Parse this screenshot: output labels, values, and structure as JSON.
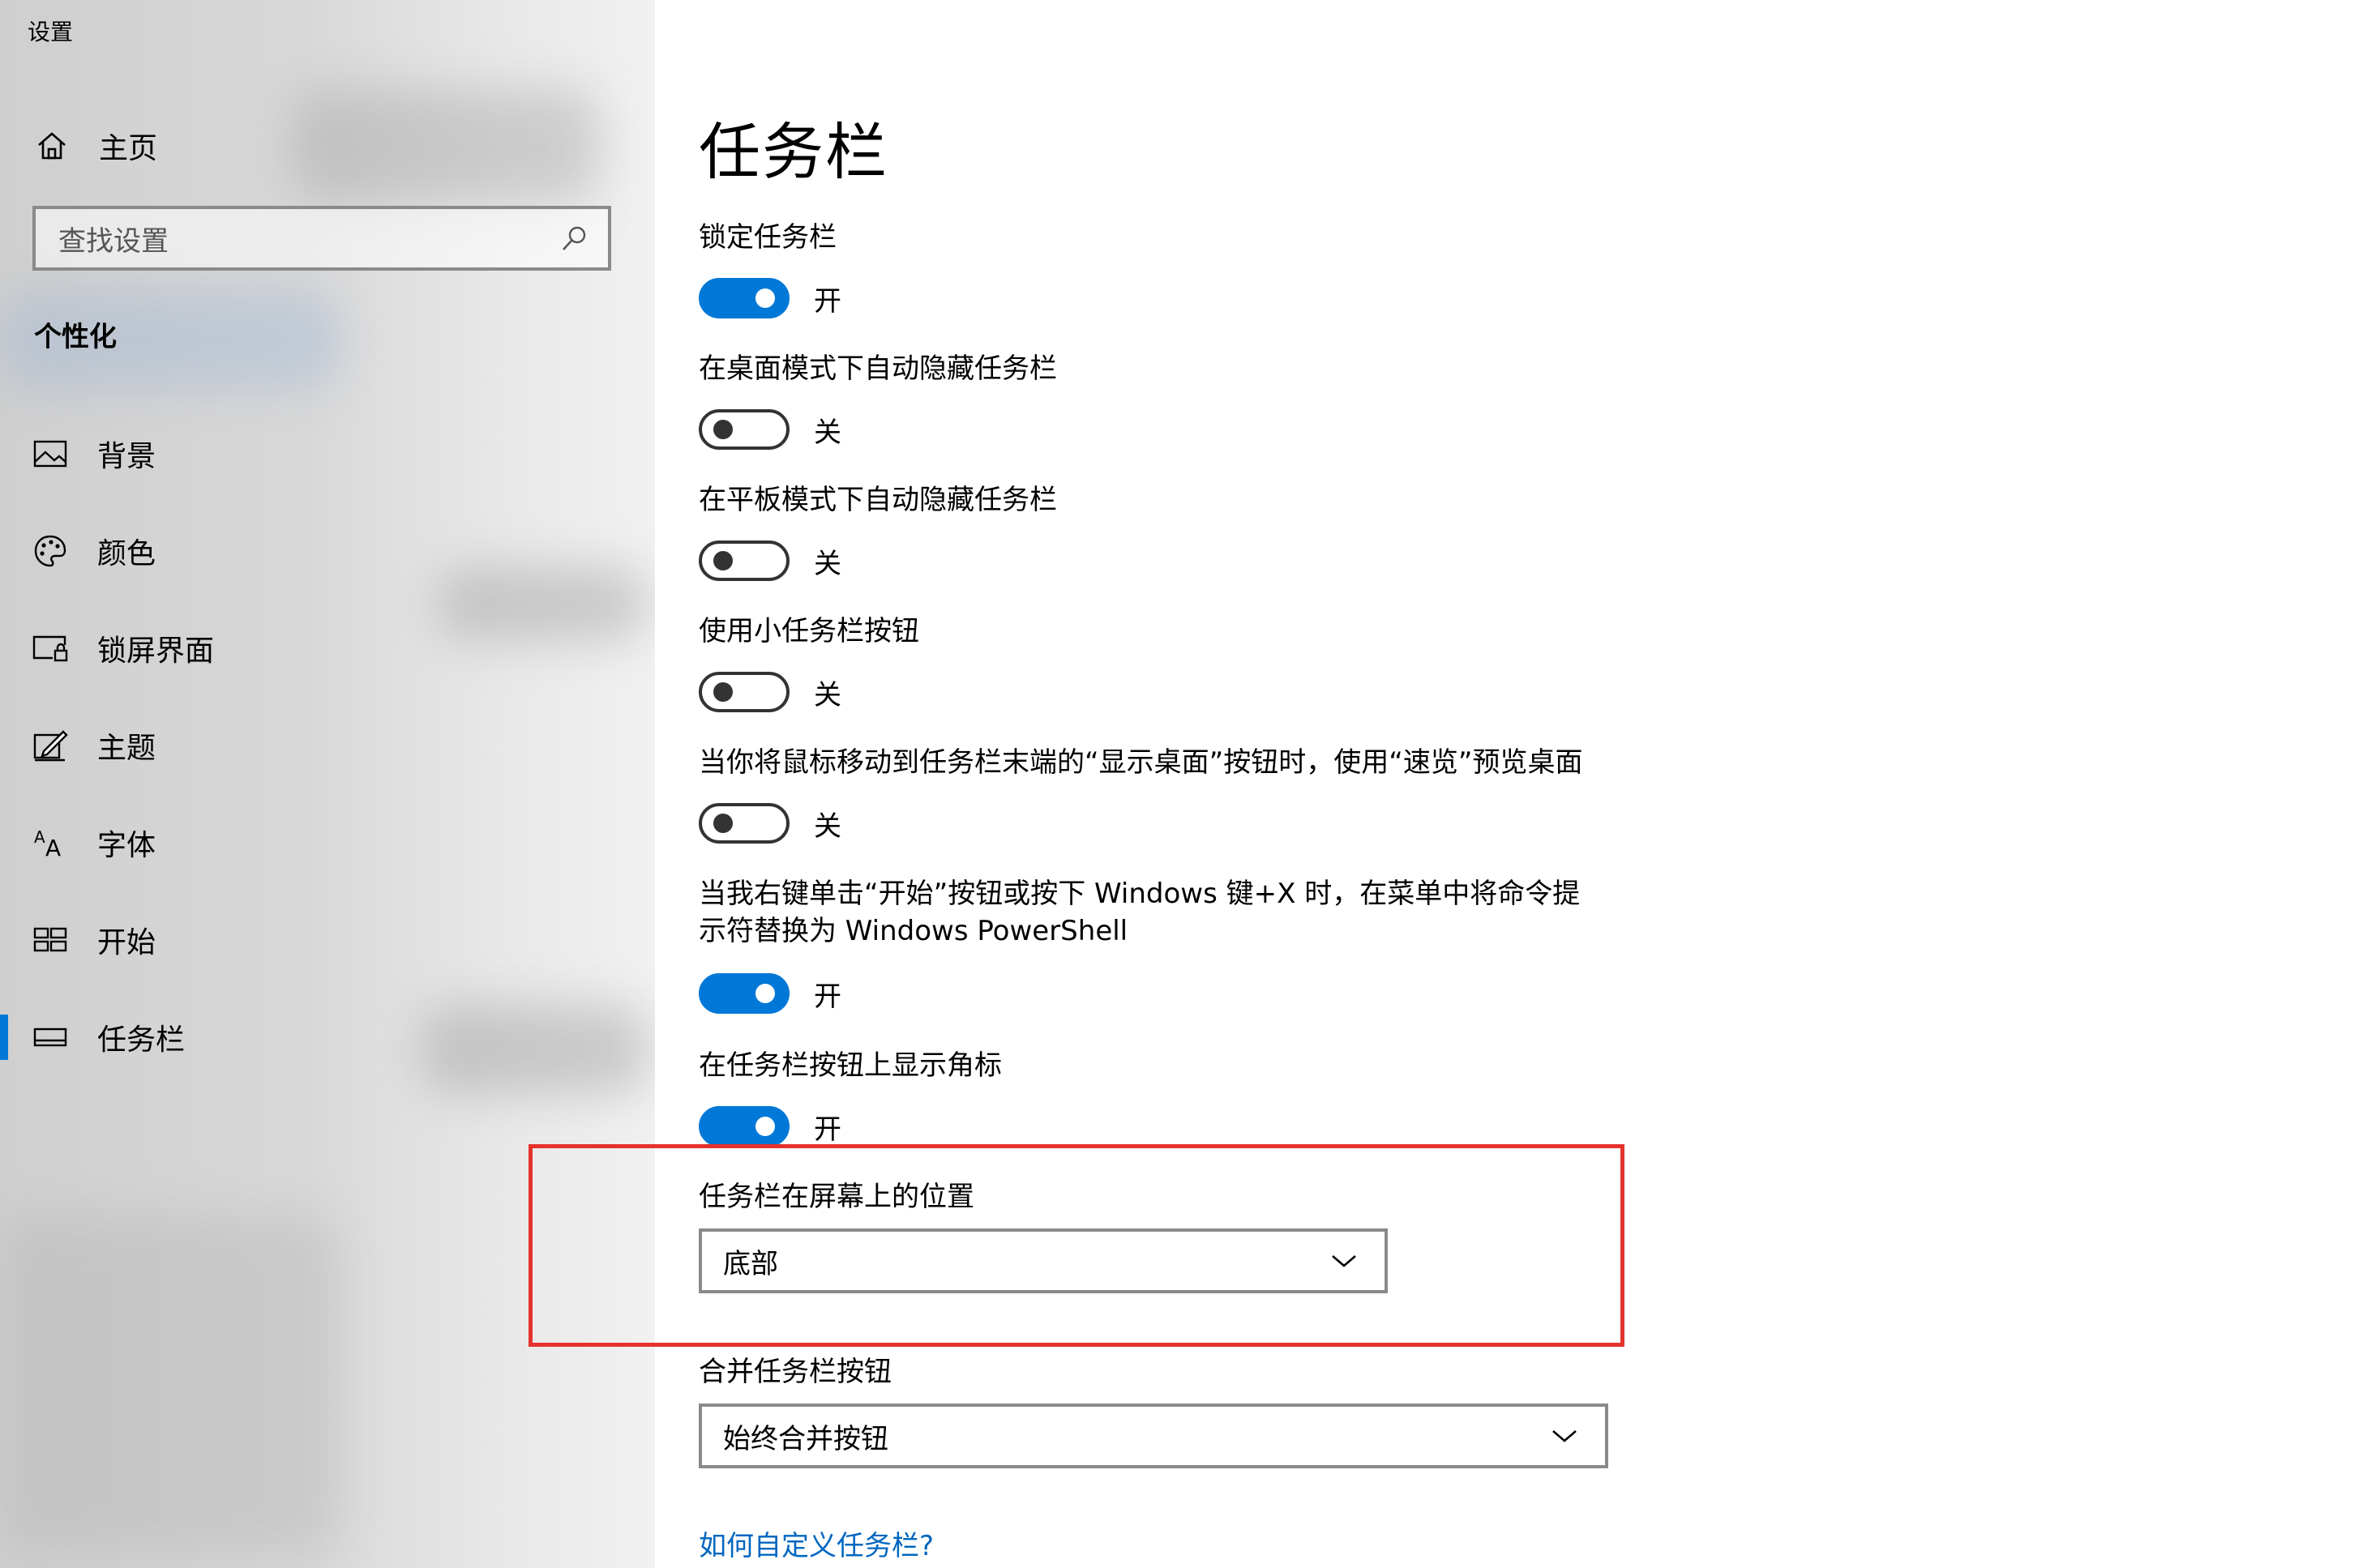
{
  "window": {
    "title": "设置"
  },
  "sidebar": {
    "home_label": "主页",
    "search_placeholder": "查找设置",
    "section_title": "个性化",
    "items": [
      {
        "label": "背景",
        "icon": "picture-icon",
        "selected": false
      },
      {
        "label": "颜色",
        "icon": "palette-icon",
        "selected": false
      },
      {
        "label": "锁屏界面",
        "icon": "lock-screen-icon",
        "selected": false
      },
      {
        "label": "主题",
        "icon": "theme-icon",
        "selected": false
      },
      {
        "label": "字体",
        "icon": "font-icon",
        "selected": false
      },
      {
        "label": "开始",
        "icon": "start-icon",
        "selected": false
      },
      {
        "label": "任务栏",
        "icon": "taskbar-icon",
        "selected": true
      }
    ]
  },
  "main": {
    "title": "任务栏",
    "settings": [
      {
        "label": "锁定任务栏",
        "state": "开",
        "on": true
      },
      {
        "label": "在桌面模式下自动隐藏任务栏",
        "state": "关",
        "on": false
      },
      {
        "label": "在平板模式下自动隐藏任务栏",
        "state": "关",
        "on": false
      },
      {
        "label": "使用小任务栏按钮",
        "state": "关",
        "on": false
      },
      {
        "label": "当你将鼠标移动到任务栏末端的“显示桌面”按钮时，使用“速览”预览桌面",
        "state": "关",
        "on": false
      },
      {
        "label_line1": "当我右键单击“开始”按钮或按下 Windows 键+X 时，在菜单中将命令提",
        "label_line2": "示符替换为 Windows PowerShell",
        "state": "开",
        "on": true
      },
      {
        "label": "在任务栏按钮上显示角标",
        "state": "开",
        "on": true
      }
    ],
    "position": {
      "label": "任务栏在屏幕上的位置",
      "value": "底部"
    },
    "combine": {
      "label": "合并任务栏按钮",
      "value": "始终合并按钮"
    },
    "help_link": "如何自定义任务栏?"
  },
  "colors": {
    "accent": "#0078d7",
    "highlight": "#e5322d",
    "link": "#0067c0"
  }
}
